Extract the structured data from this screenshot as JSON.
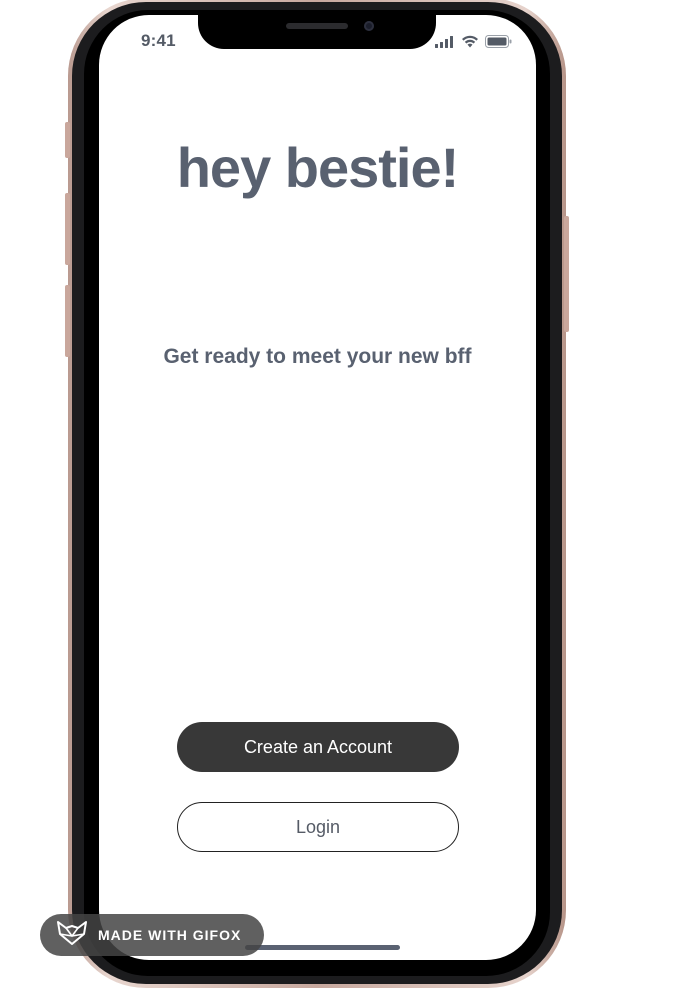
{
  "status_bar": {
    "time": "9:41",
    "icons": [
      "signal-icon",
      "wifi-icon",
      "battery-icon"
    ]
  },
  "onboarding": {
    "heading": "hey bestie!",
    "subtitle": "Get ready to meet your new bff"
  },
  "actions": {
    "create_account_label": "Create an Account",
    "login_label": "Login"
  },
  "watermark": {
    "label": "MADE WITH GIFOX",
    "icon": "fox-logo-icon"
  },
  "colors": {
    "heading_text": "#596170",
    "primary_button": "#383838",
    "primary_button_text": "#ffffff",
    "secondary_button_border": "#222222",
    "frame_gold": "#c7a89e"
  }
}
